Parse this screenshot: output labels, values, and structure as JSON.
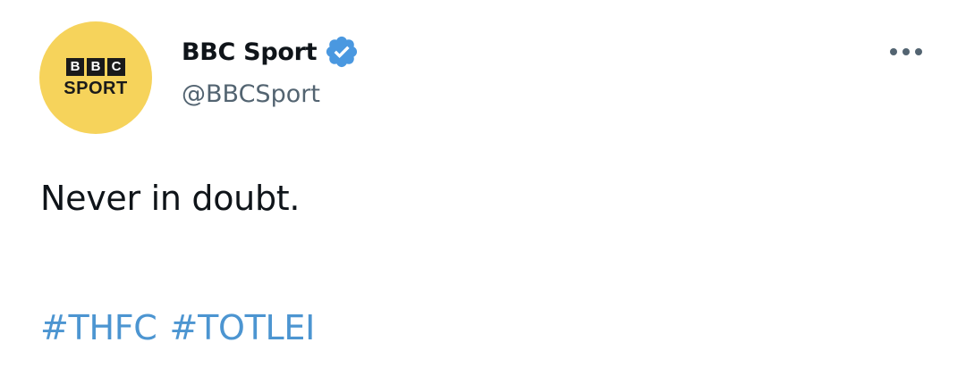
{
  "tweet": {
    "author": {
      "display_name": "BBC Sport",
      "handle": "@BBCSport",
      "verified": true,
      "avatar": {
        "bbc_letters": [
          "B",
          "B",
          "C"
        ],
        "sport_word": "SPORT",
        "background_color": "#f6d35b"
      }
    },
    "more_icon": "more-dots-icon",
    "text": "Never in doubt.",
    "hashtags": [
      "#THFC",
      "#TOTLEI"
    ],
    "colors": {
      "hashtag": "#4c95d1",
      "verified_badge": "#4a98e0",
      "handle": "#536471"
    }
  }
}
